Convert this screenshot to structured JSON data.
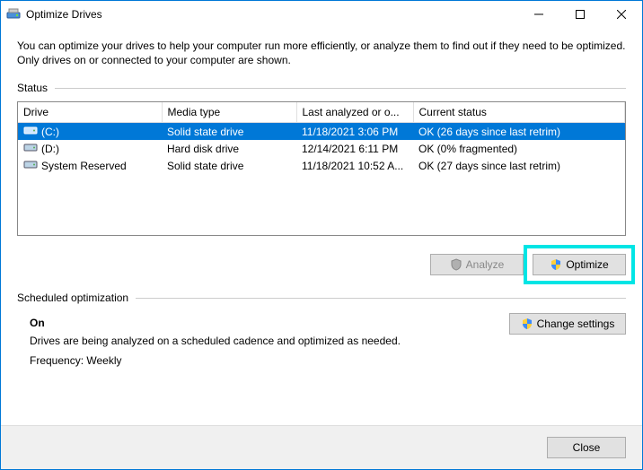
{
  "window": {
    "title": "Optimize Drives"
  },
  "intro": "You can optimize your drives to help your computer run more efficiently, or analyze them to find out if they need to be optimized. Only drives on or connected to your computer are shown.",
  "status": {
    "label": "Status",
    "columns": {
      "drive": "Drive",
      "media": "Media type",
      "last": "Last analyzed or o...",
      "status": "Current status"
    },
    "rows": [
      {
        "name": "(C:)",
        "media": "Solid state drive",
        "last": "11/18/2021 3:06 PM",
        "status": "OK (26 days since last retrim)",
        "selected": true
      },
      {
        "name": "(D:)",
        "media": "Hard disk drive",
        "last": "12/14/2021 6:11 PM",
        "status": "OK (0% fragmented)",
        "selected": false
      },
      {
        "name": "System Reserved",
        "media": "Solid state drive",
        "last": "11/18/2021 10:52 A...",
        "status": "OK (27 days since last retrim)",
        "selected": false
      }
    ]
  },
  "buttons": {
    "analyze": "Analyze",
    "optimize": "Optimize",
    "change_settings": "Change settings",
    "close": "Close"
  },
  "schedule": {
    "label": "Scheduled optimization",
    "on": "On",
    "desc": "Drives are being analyzed on a scheduled cadence and optimized as needed.",
    "freq": "Frequency: Weekly"
  }
}
